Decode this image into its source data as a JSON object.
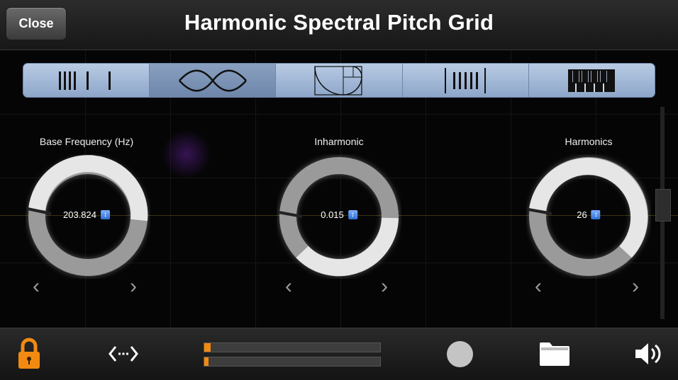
{
  "app": {
    "title": "Harmonic Spectral Pitch Grid",
    "close_label": "Close"
  },
  "modes": [
    {
      "icon": "bars-pattern-icon",
      "active": false
    },
    {
      "icon": "wave-icon",
      "active": true
    },
    {
      "icon": "golden-spiral-icon",
      "active": false
    },
    {
      "icon": "dense-bars-icon",
      "active": false
    },
    {
      "icon": "piano-keys-icon",
      "active": false
    }
  ],
  "knobs": [
    {
      "label": "Base Frequency (Hz)",
      "value": "203.824"
    },
    {
      "label": "Inharmonic",
      "value": "0.015"
    },
    {
      "label": "Harmonics",
      "value": "26"
    }
  ],
  "bottom": {
    "lock_icon": "lock-icon",
    "range_icon": "horizontal-range-icon",
    "sliders": [
      {
        "value": 0
      },
      {
        "value": 0
      }
    ],
    "record_icon": "record-button-icon",
    "folder_icon": "folder-icon",
    "volume_icon": "speaker-icon"
  },
  "colors": {
    "mode_bar": "#a8bcd9",
    "accent_orange": "#f28a12",
    "knob_fill": "#e6e6e6",
    "knob_track": "#9a9a9a"
  }
}
